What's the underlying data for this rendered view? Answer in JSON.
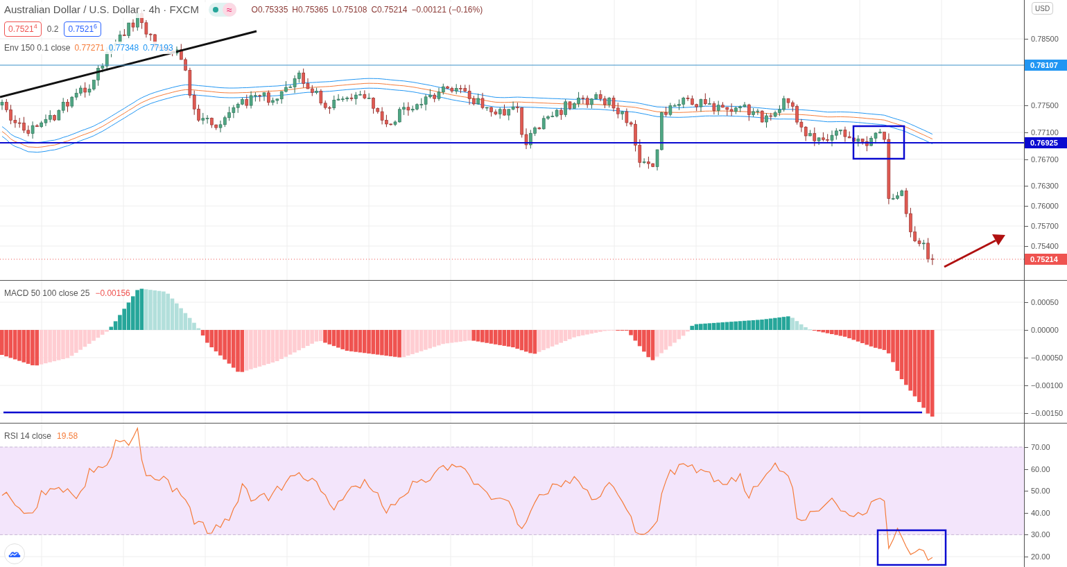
{
  "header": {
    "title": "Australian Dollar / U.S. Dollar · 4h · FXCM",
    "status_symbol": "≈",
    "ohlc": [
      "O0.75335",
      "H0.75365",
      "L0.75108",
      "C0.75214",
      "−0.00121 (−0.16%)"
    ]
  },
  "trade": {
    "sell_price": "0.7521$^{4}$",
    "spread": "0.2",
    "buy_price": "0.7521$^{6}$"
  },
  "envelope": {
    "label": "Env 150 0.1 close",
    "values": [
      {
        "text": "0.77271",
        "color": "#f57c3a"
      },
      {
        "text": "0.77348",
        "color": "#2196f3"
      },
      {
        "text": "0.77193",
        "color": "#2196f3"
      }
    ]
  },
  "price_pane": {
    "currency_button": "USD",
    "axis_ticks": [
      "0.78500",
      "0.77500",
      "0.77100",
      "0.76700",
      "0.76300",
      "0.76000",
      "0.75700",
      "0.75400"
    ],
    "price_badges": [
      {
        "text": "0.78107",
        "color": "#2196f3"
      },
      {
        "text": "0.76925",
        "color": "#0a0ad0"
      },
      {
        "text": "0.75214",
        "color": "#ef5350"
      }
    ]
  },
  "macd_pane": {
    "label": "MACD 50 100 close 25",
    "value": "−0.00156",
    "axis_ticks": [
      "0.00050",
      "0.00000",
      "−0.00050",
      "−0.00100",
      "−0.00150"
    ]
  },
  "rsi_pane": {
    "label": "RSI 14 close",
    "value": "19.58",
    "axis_ticks": [
      "70.00",
      "60.00",
      "50.00",
      "40.00",
      "30.00",
      "20.00"
    ]
  }
}
